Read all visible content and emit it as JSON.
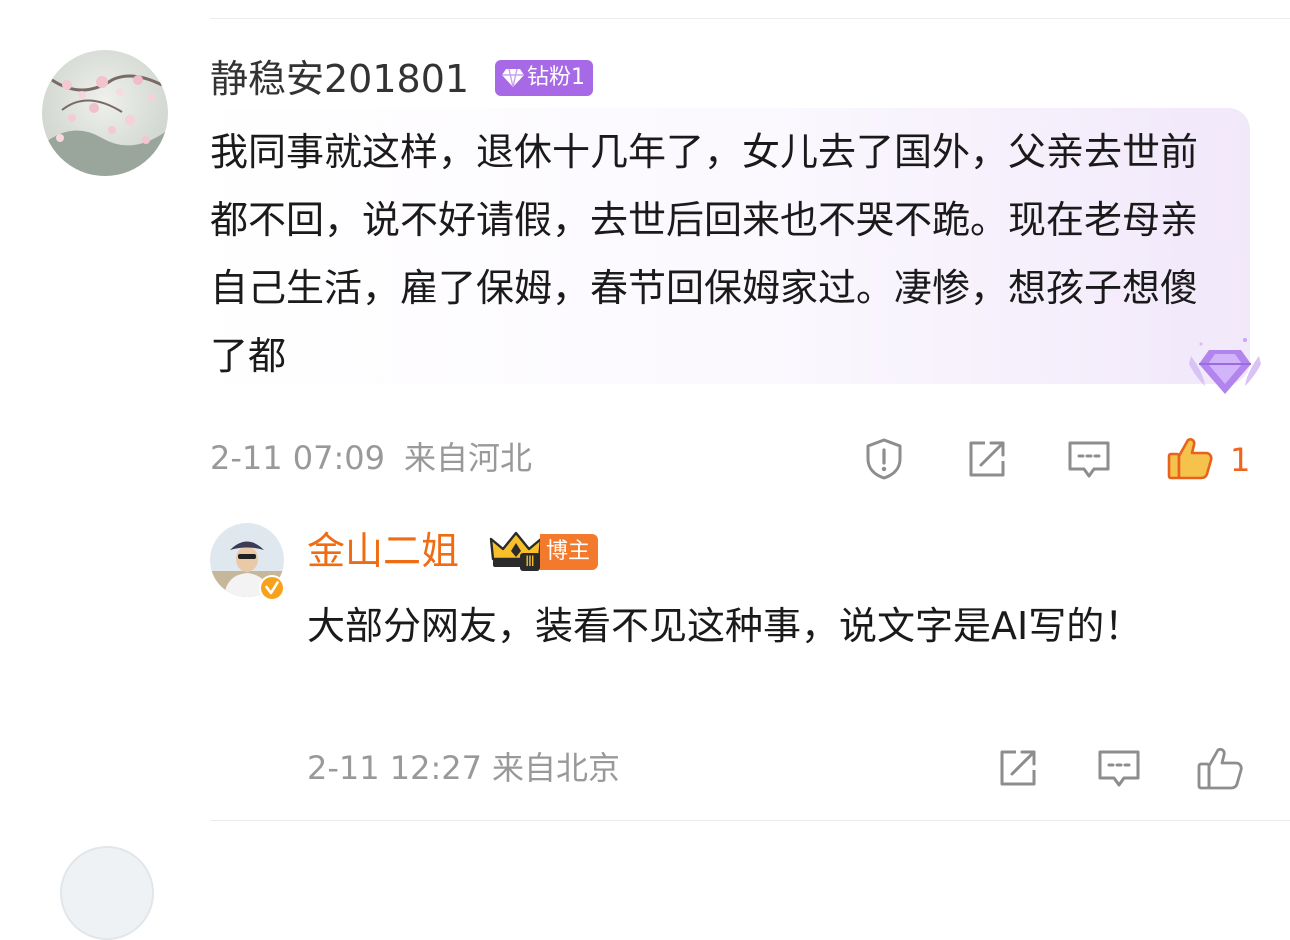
{
  "comments": [
    {
      "username": "静稳安201801",
      "badge": {
        "label": "钻粉1",
        "color": "#a769e6",
        "icon": "diamond-icon"
      },
      "text": "我同事就这样，退休十几年了，女儿去了国外，父亲去世前都不回，说不好请假，去世后回来也不哭不跪。现在老母亲自己生活，雇了保姆，春节回保姆家过。凄惨，想孩子想傻了都",
      "time": "2-11 07:09",
      "location": "来自河北",
      "like_count": "1",
      "liked": true,
      "accent_color": "#f0641e"
    }
  ],
  "reply": {
    "username": "金山二姐",
    "username_color": "#f06c12",
    "badge": {
      "label": "博主",
      "color": "#f3792d",
      "level": "Ⅲ",
      "icon": "crown-icon"
    },
    "text": "大部分网友，装看不见这种事，说文字是AI写的！",
    "time": "2-11 12:27",
    "location": "来自北京",
    "verified_icon": "verified-badge-icon"
  }
}
